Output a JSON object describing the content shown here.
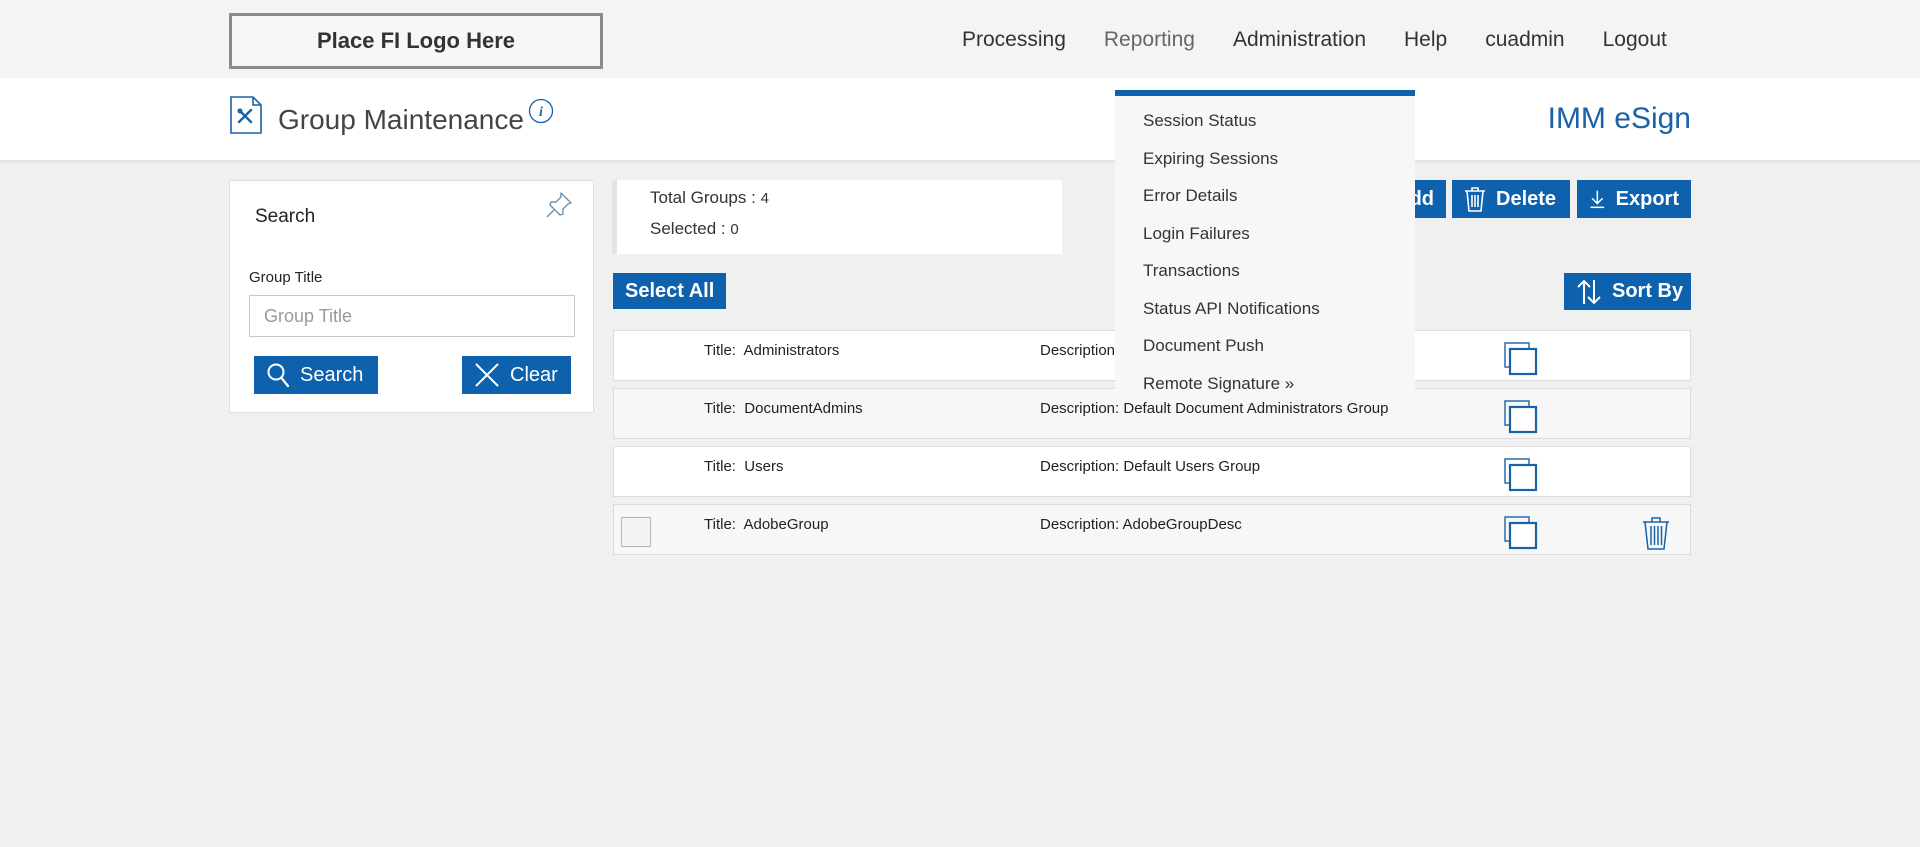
{
  "header": {
    "logo_text": "Place FI Logo Here",
    "nav": [
      "Processing",
      "Reporting",
      "Administration",
      "Help",
      "cuadmin",
      "Logout"
    ],
    "page_title": "Group Maintenance",
    "brand": "IMM eSign"
  },
  "search": {
    "title": "Search",
    "field_label": "Group Title",
    "field_placeholder": "Group Title",
    "search_button": "Search",
    "clear_button": "Clear"
  },
  "summary": {
    "total_label": "Total Groups : ",
    "total_value": "4",
    "selected_label": "Selected : ",
    "selected_value": "0"
  },
  "toolbar": {
    "add_label": "dd",
    "delete_label": "Delete",
    "export_label": "Export",
    "select_all_label": "Select All",
    "sort_by_label": "Sort By"
  },
  "groups": [
    {
      "title_label": "Title:",
      "title": "Administrators",
      "desc_label": "Description",
      "description": ""
    },
    {
      "title_label": "Title:",
      "title": "DocumentAdmins",
      "desc_label": "Description:",
      "description": "Default Document Administrators Group"
    },
    {
      "title_label": "Title:",
      "title": "Users",
      "desc_label": "Description:",
      "description": "Default Users Group"
    },
    {
      "title_label": "Title:",
      "title": "AdobeGroup",
      "desc_label": "Description:",
      "description": "AdobeGroupDesc"
    }
  ],
  "reporting_menu": [
    "Session Status",
    "Expiring Sessions",
    "Error Details",
    "Login Failures",
    "Transactions",
    "Status API Notifications",
    "Document Push",
    "Remote Signature »"
  ],
  "colors": {
    "accent": "#0d61ad",
    "brand": "#1a62a8"
  }
}
